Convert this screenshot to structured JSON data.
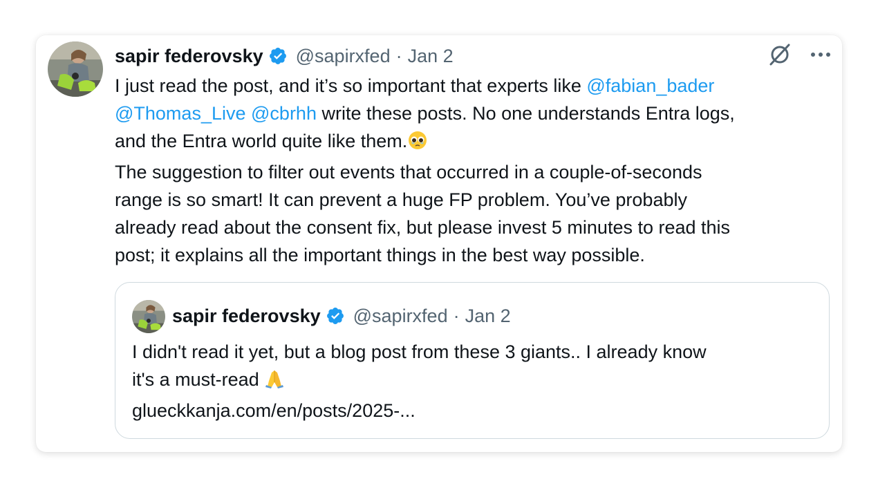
{
  "tweet": {
    "author_name": "sapir federovsky",
    "handle": "@sapirxfed",
    "separator": "·",
    "date": "Jan 2",
    "more_label": "···",
    "text": {
      "l1_a": "I just read the post, and it’s so important that experts like ",
      "m1": "@fabian_bader",
      "m2": "@Thomas_Live",
      "l2_sp": " ",
      "m3": "@cbrhh",
      "l2_b": " write these posts. No one understands Entra logs,",
      "l3": "and the Entra world quite like them.",
      "l4": "The suggestion to filter out events that occurred in a couple-of-seconds",
      "l5": "range is so smart! It can prevent a huge FP problem. You’ve probably",
      "l6": "already read about the consent fix, but please invest 5 minutes to read this",
      "l7": "post; it explains all the important things in the best way possible."
    }
  },
  "quoted": {
    "author_name": "sapir federovsky",
    "handle": "@sapirxfed",
    "separator": "·",
    "date": "Jan 2",
    "text": {
      "l1": "I didn't read it yet, but a blog post from these 3 giants.. I already know",
      "l2": "it's a must-read ",
      "link": "glueckkanja.com/en/posts/2025-..."
    }
  },
  "icons": {
    "verified": "verified-badge-icon",
    "grok": "grok-icon",
    "more": "more-options-icon",
    "emoji_teary": "pleading-face-emoji",
    "emoji_pray": "folded-hands-emoji"
  },
  "colors": {
    "accent": "#1d9bf0",
    "text": "#0f1419",
    "secondary": "#536471",
    "border": "#cfd9de"
  }
}
